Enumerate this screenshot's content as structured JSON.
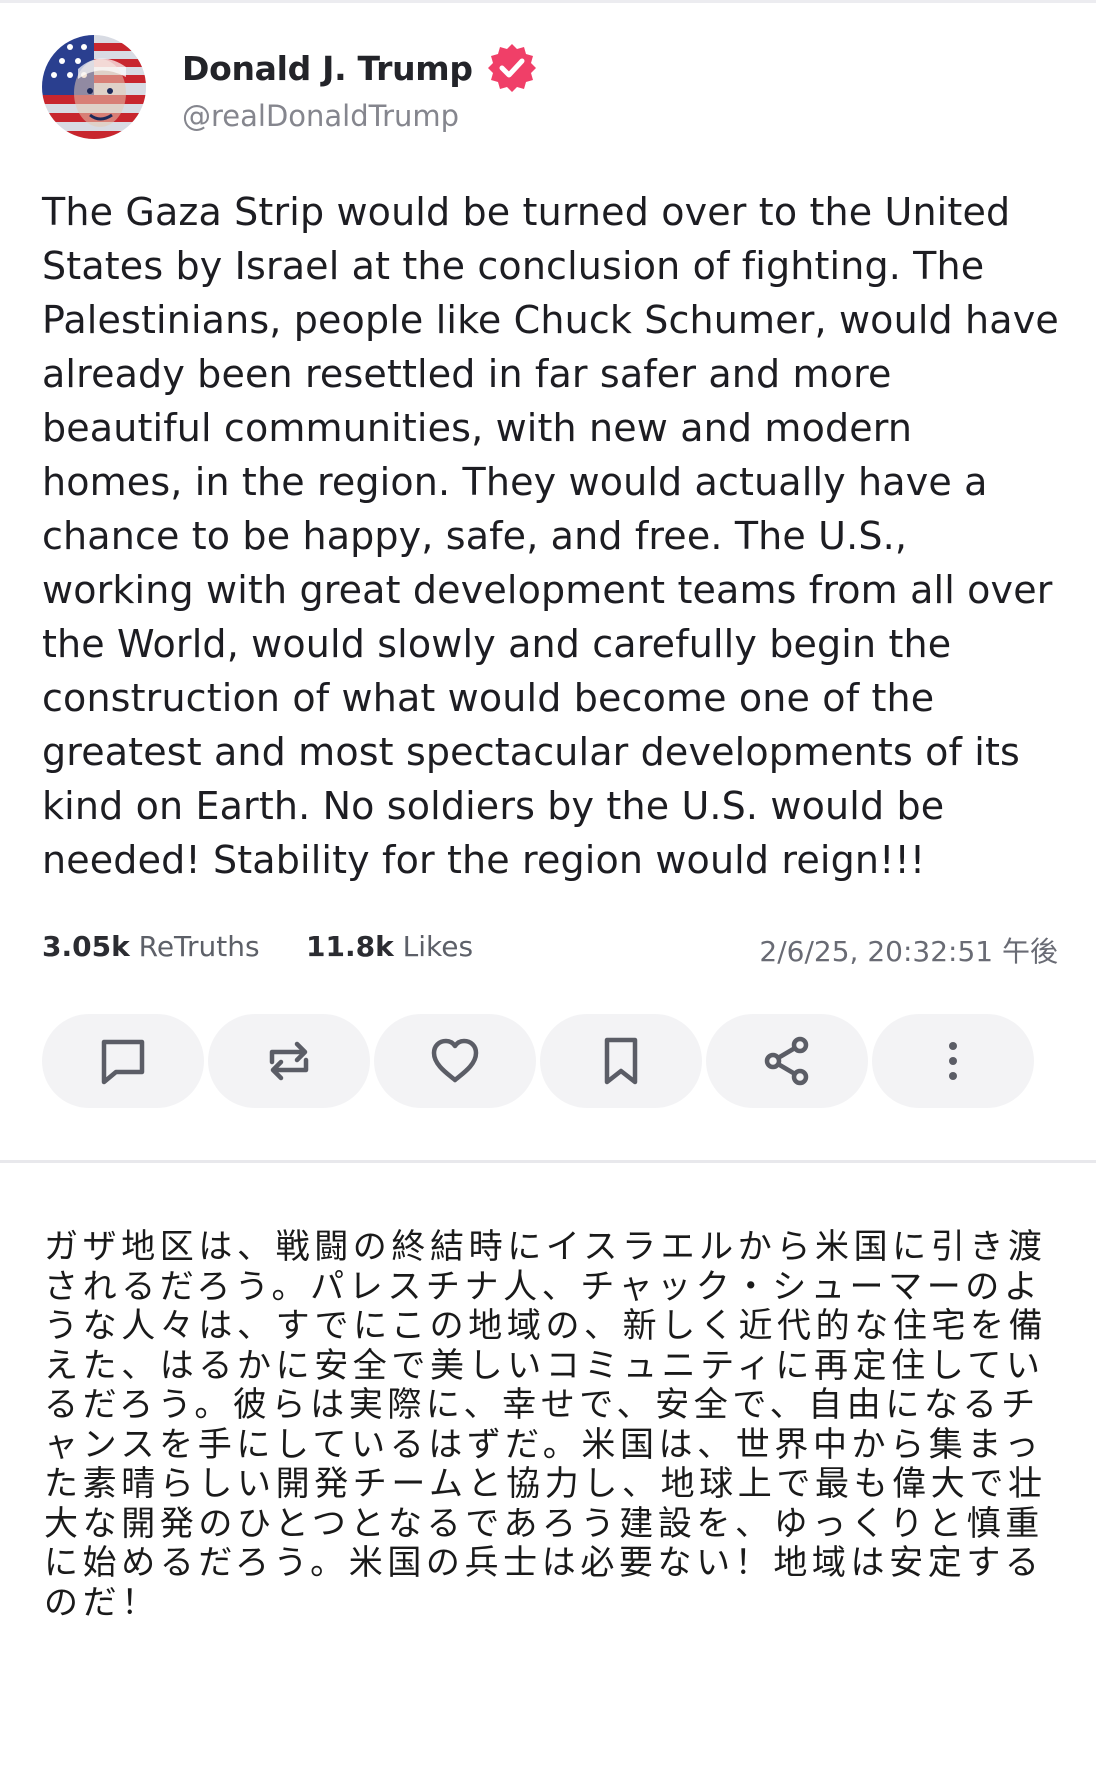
{
  "author": {
    "display_name": "Donald J. Trump",
    "handle": "@realDonaldTrump",
    "verified": true,
    "verified_color": "#f03f68",
    "avatar_icon": "flag-portrait-avatar"
  },
  "post": {
    "text": "The Gaza Strip would be turned over to the United States by Israel at the conclusion of fighting. The Palestinians, people like Chuck Schumer, would have already been resettled in far safer and more beautiful communities, with new and modern homes, in the region. They would actually have a chance to be happy, safe, and free. The U.S., working with great development teams from all over the World, would slowly and carefully begin the construction of what would become one of the greatest and most spectacular developments of its kind on Earth. No soldiers by the U.S. would be needed! Stability for the region would reign!!!"
  },
  "stats": {
    "retruths_count": "3.05k",
    "retruths_label": "ReTruths",
    "likes_count": "11.8k",
    "likes_label": "Likes",
    "timestamp": "2/6/25, 20:32:51 午後"
  },
  "actions": [
    {
      "name": "reply",
      "icon": "comment-icon"
    },
    {
      "name": "retruth",
      "icon": "repost-icon"
    },
    {
      "name": "like",
      "icon": "heart-icon"
    },
    {
      "name": "bookmark",
      "icon": "bookmark-icon"
    },
    {
      "name": "share",
      "icon": "share-icon"
    },
    {
      "name": "more",
      "icon": "more-vertical-icon"
    }
  ],
  "translation": {
    "text": "ガザ地区は、戦闘の終結時にイスラエルから米国に引き渡されるだろう。パレスチナ人、チャック・シューマーのような人々は、すでにこの地域の、新しく近代的な住宅を備えた、はるかに安全で美しいコミュニティに再定住しているだろう。彼らは実際に、幸せで、安全で、自由になるチャンスを手にしているはずだ。米国は、世界中から集まった素晴らしい開発チームと協力し、地球上で最も偉大で壮大な開発のひとつとなるであろう建設を、ゆっくりと慎重に始めるだろう。米国の兵士は必要ない！地域は安定するのだ！"
  },
  "colors": {
    "text_primary": "#1d1d22",
    "text_secondary": "#85868e",
    "button_bg": "#f3f3f5",
    "icon_color": "#5b5d66"
  }
}
